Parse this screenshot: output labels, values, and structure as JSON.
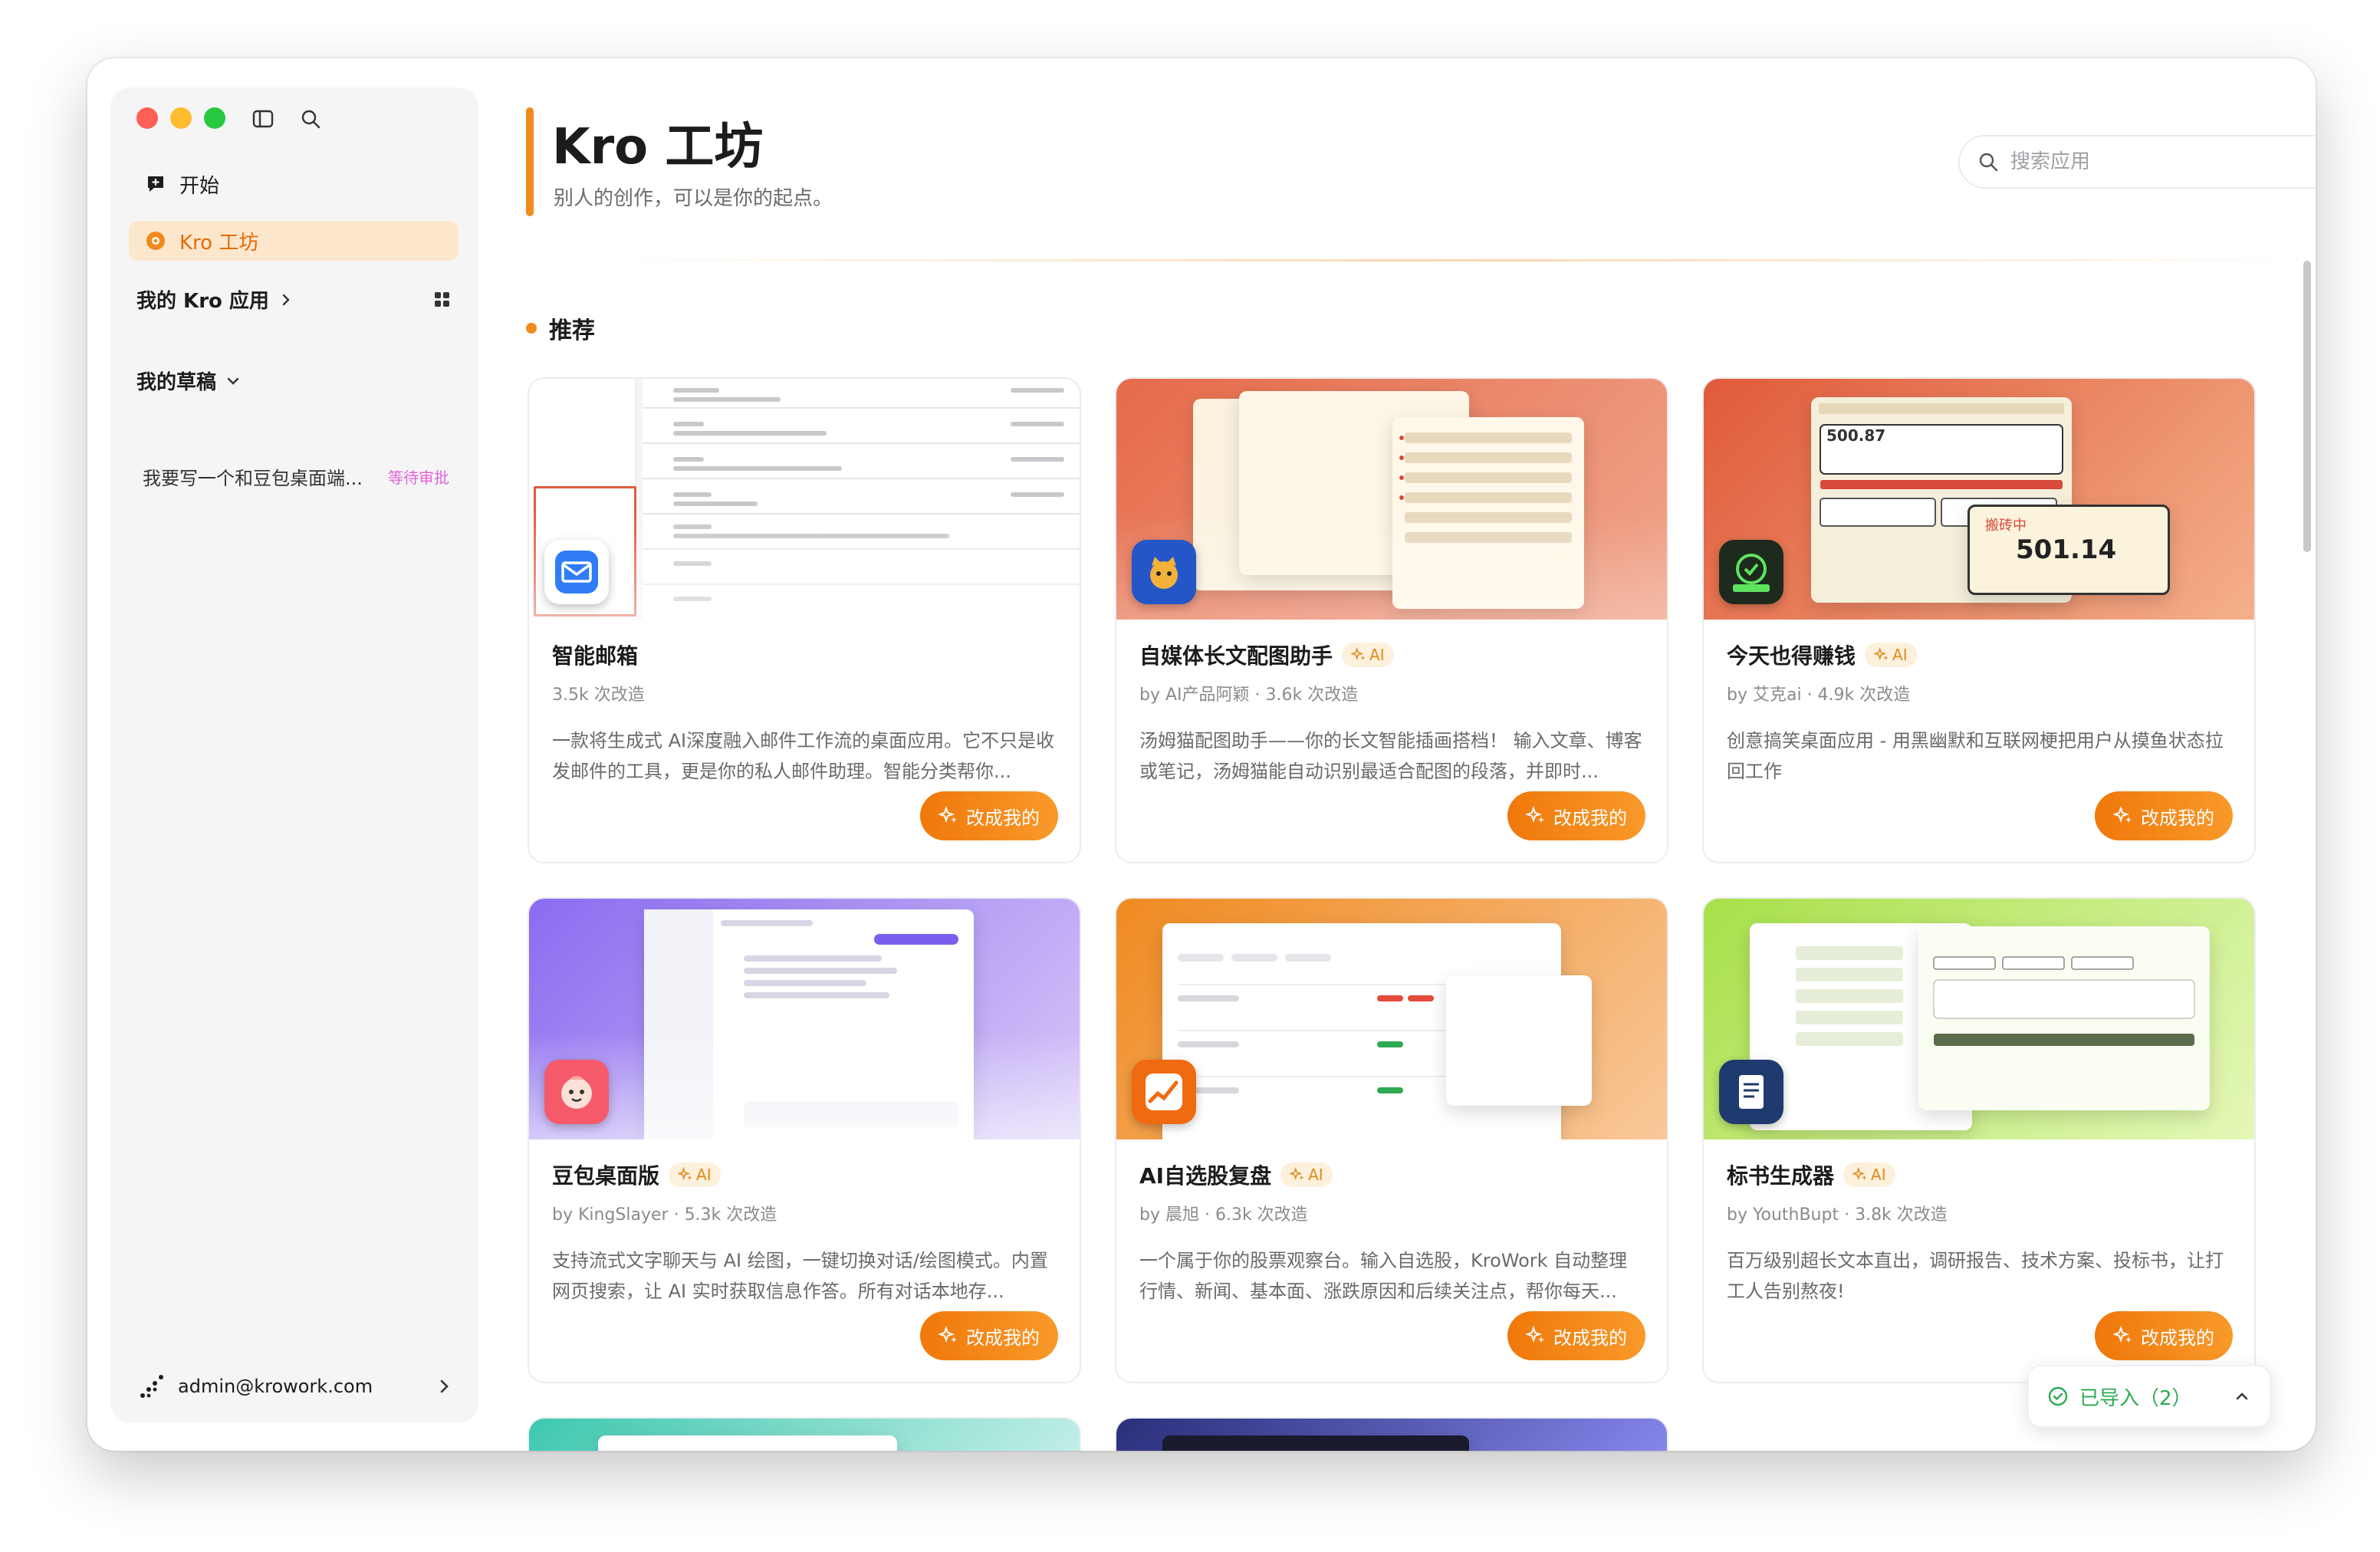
{
  "sidebar": {
    "nav": [
      {
        "label": "开始",
        "icon": "chat-plus-icon"
      },
      {
        "label": "Kro 工坊",
        "icon": "workshop-icon"
      }
    ],
    "my_apps": "我的 Kro 应用",
    "drafts_title": "我的草稿",
    "drafts": [
      {
        "title": "我要写一个和豆包桌面端...",
        "status": "等待审批"
      }
    ],
    "account": "admin@krowork.com"
  },
  "header": {
    "title": "Kro 工坊",
    "subtitle": "别人的创作，可以是你的起点。",
    "search_placeholder": "搜索应用"
  },
  "section": {
    "title": "推荐"
  },
  "cards": [
    {
      "title": "智能邮箱",
      "ai": false,
      "meta": "3.5k 次改造",
      "desc": "一款将生成式 AI深度融入邮件工作流的桌面应用。它不只是收发邮件的工具，更是你的私人邮件助理。智能分类帮你...",
      "button": "改成我的"
    },
    {
      "title": "自媒体长文配图助手",
      "ai": true,
      "meta": "by AI产品阿颖 · 3.6k 次改造",
      "desc": "汤姆猫配图助手——你的长文智能插画搭档！ 输入文章、博客或笔记，汤姆猫能自动识别最适合配图的段落，并即时...",
      "button": "改成我的"
    },
    {
      "title": "今天也得赚钱",
      "ai": true,
      "meta": "by 艾克ai · 4.9k 次改造",
      "desc": "创意搞笑桌面应用 - 用黑幽默和互联网梗把用户从摸鱼状态拉回工作",
      "button": "改成我的"
    },
    {
      "title": "豆包桌面版",
      "ai": true,
      "meta": "by KingSlayer · 5.3k 次改造",
      "desc": "支持流式文字聊天与 AI 绘图，一键切换对话/绘图模式。内置网页搜索，让 AI 实时获取信息作答。所有对话本地存...",
      "button": "改成我的"
    },
    {
      "title": "AI自选股复盘",
      "ai": true,
      "meta": "by 晨旭 · 6.3k 次改造",
      "desc": "一个属于你的股票观察台。输入自选股，KroWork 自动整理行情、新闻、基本面、涨跌原因和后续关注点，帮你每天...",
      "button": "改成我的"
    },
    {
      "title": "标书生成器",
      "ai": true,
      "meta": "by YouthBupt · 3.8k 次改造",
      "desc": "百万级别超长文本直出，调研报告、技术方案、投标书，让打工人告别熬夜!",
      "button": "改成我的"
    }
  ],
  "ai_label": "AI",
  "thumb_preview": {
    "card3_amount": "501.14",
    "card3_earning": "搬砖中",
    "card3_small": "500.87"
  },
  "import_status": "已导入（2）",
  "colors": {
    "accent": "#f08a1c",
    "button": "#f0780a",
    "success": "#2eaa52",
    "pending": "#e063d8"
  }
}
